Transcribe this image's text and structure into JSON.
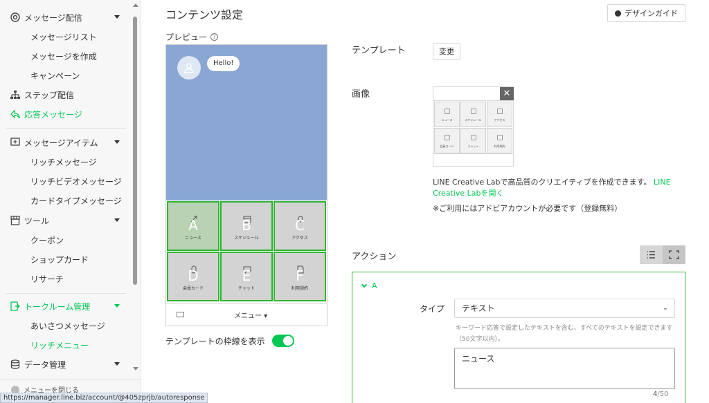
{
  "sidebar": {
    "groups": [
      {
        "label": "メッセージ配信",
        "icon": "broadcast-icon",
        "expanded": true,
        "items": [
          "メッセージリスト",
          "メッセージを作成",
          "キャンペーン"
        ]
      },
      {
        "label": "ステップ配信",
        "icon": "step-tree-icon"
      },
      {
        "label": "応答メッセージ",
        "icon": "reply-icon"
      },
      {
        "label": "メッセージアイテム",
        "icon": "message-item-icon",
        "expanded": true,
        "items": [
          "リッチメッセージ",
          "リッチビデオメッセージ",
          "カードタイプメッセージ"
        ]
      },
      {
        "label": "ツール",
        "icon": "shop-icon",
        "expanded": true,
        "items": [
          "クーポン",
          "ショップカード",
          "リサーチ"
        ]
      },
      {
        "label": "トークルーム管理",
        "icon": "talk-room-icon",
        "expanded": true,
        "items": [
          "あいさつメッセージ",
          "リッチメニュー"
        ]
      },
      {
        "label": "データ管理",
        "icon": "database-icon"
      }
    ],
    "footer_label": "メニューを閉じる"
  },
  "status_url": "https://manager.line.biz/account/@405zprjb/autoresponse",
  "page": {
    "title": "コンテンツ設定",
    "design_guide_label": "デザインガイド"
  },
  "preview": {
    "label": "プレビュー",
    "help": "?",
    "bubble_text": "Hello!",
    "cells": [
      {
        "letter": "A",
        "caption": "ニュース"
      },
      {
        "letter": "B",
        "caption": "スケジュール"
      },
      {
        "letter": "C",
        "caption": "アクセス"
      },
      {
        "letter": "D",
        "caption": "会員カード"
      },
      {
        "letter": "E",
        "caption": "チャット"
      },
      {
        "letter": "F",
        "caption": "利用規約"
      }
    ],
    "menu_label": "メニュー ▾",
    "border_toggle_label": "テンプレートの枠線を表示",
    "border_toggle_on": true
  },
  "template": {
    "label": "テンプレート",
    "change_label": "変更"
  },
  "image": {
    "label": "画像",
    "close": "✕",
    "mini_captions": [
      "ニュース",
      "スケジュール",
      "アクセス",
      "会員カード",
      "チャット",
      "利用規約"
    ],
    "creative_text": "LINE Creative Labで高品質のクリエイティブを作成できます。",
    "creative_link": "LINE Creative Labを開く",
    "note": "※ご利用にはアドビアカウントが必要です（登録無料）"
  },
  "action": {
    "label": "アクション",
    "item_label": "A",
    "type_label": "タイプ",
    "type_value": "テキスト",
    "type_arrow": "⌄",
    "help_line1": "キーワード応答で設定したテキストを含む、すべてのテキストを設定できます",
    "help_line2": "（50文字以内）。",
    "text_value": "ニュース",
    "count": "4",
    "max": "/50"
  },
  "colors": {
    "accent": "#06c755",
    "chat_bg": "#8aa7d4",
    "cell_border": "#2fb52f"
  }
}
